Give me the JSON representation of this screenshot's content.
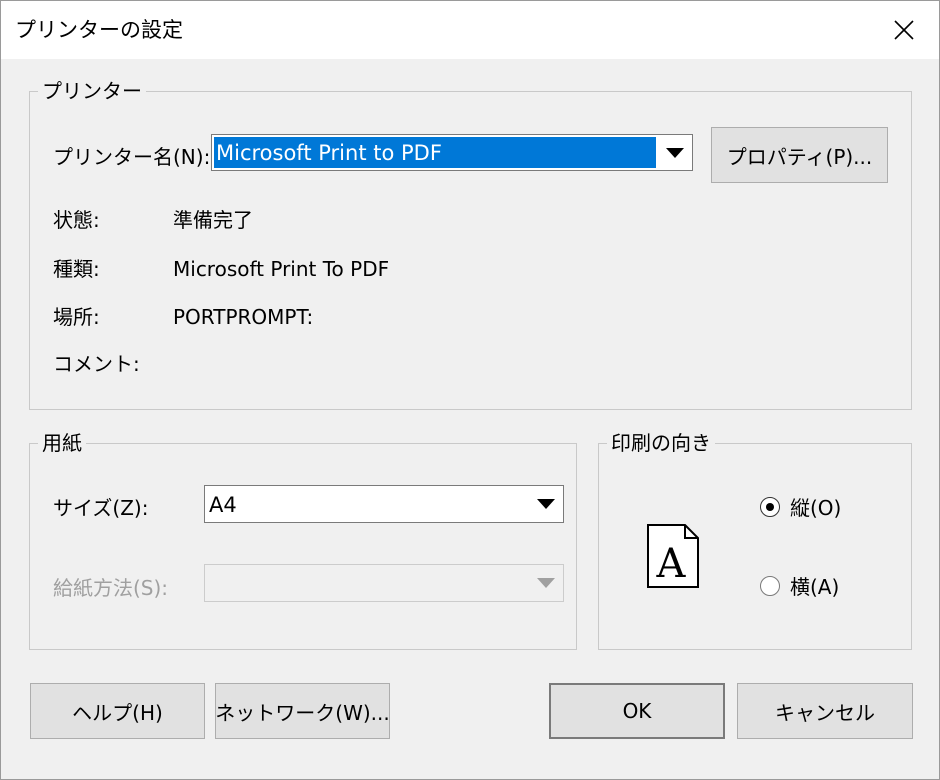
{
  "title": "プリンターの設定",
  "printer_group": {
    "label": "プリンター",
    "name_label": "プリンター名(N):",
    "selected_printer": "Microsoft Print to PDF",
    "properties_button": "プロパティ(P)...",
    "status_label": "状態:",
    "status_value": "準備完了",
    "type_label": "種類:",
    "type_value": "Microsoft Print To PDF",
    "where_label": "場所:",
    "where_value": "PORTPROMPT:",
    "comment_label": "コメント:",
    "comment_value": ""
  },
  "paper_group": {
    "label": "用紙",
    "size_label": "サイズ(Z):",
    "size_value": "A4",
    "source_label": "給紙方法(S):",
    "source_value": ""
  },
  "orientation_group": {
    "label": "印刷の向き",
    "portrait_label": "縦(O)",
    "landscape_label": "横(A)",
    "selected": "portrait",
    "preview_letter": "A"
  },
  "buttons": {
    "help": "ヘルプ(H)",
    "network": "ネットワーク(W)...",
    "ok": "OK",
    "cancel": "キャンセル"
  }
}
